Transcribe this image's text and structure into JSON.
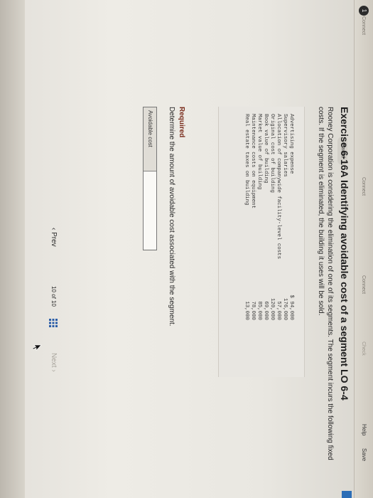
{
  "header": {
    "badge_number": "1",
    "tabs": [
      "Connect",
      "Connect",
      "Connect",
      "Check"
    ],
    "help_label": "Help",
    "save_label": "Save",
    "saved_status": "Saved"
  },
  "exercise": {
    "title": "Exercise 6-16A Identifying avoidable cost of a segment LO 6-4",
    "intro": "Rooney Corporation is considering the elimination of one of its segments. The segment incurs the following fixed costs. If the segment is eliminated, the building it uses will be sold.",
    "costs": [
      {
        "label": "Advertising expense",
        "amount": "$ 94,000"
      },
      {
        "label": "Supervisory salaries",
        "amount": "176,000"
      },
      {
        "label": "Allocation of companywide facility-level costs",
        "amount": "57,000"
      },
      {
        "label": "Original cost of building",
        "amount": "120,000"
      },
      {
        "label": "Book value of building",
        "amount": "69,000"
      },
      {
        "label": "Market value of building",
        "amount": "85,000"
      },
      {
        "label": "Maintenance costs on equipment",
        "amount": "78,000"
      },
      {
        "label": "Real estate taxes on building",
        "amount": "13,000"
      }
    ]
  },
  "required": {
    "heading": "Required",
    "text": "Determine the amount of avoidable cost associated with the segment.",
    "answer_label": "Avoidable cost",
    "answer_value": ""
  },
  "navigation": {
    "prev_label": "Prev",
    "page_count": "10 of 10",
    "next_label": "Next"
  }
}
